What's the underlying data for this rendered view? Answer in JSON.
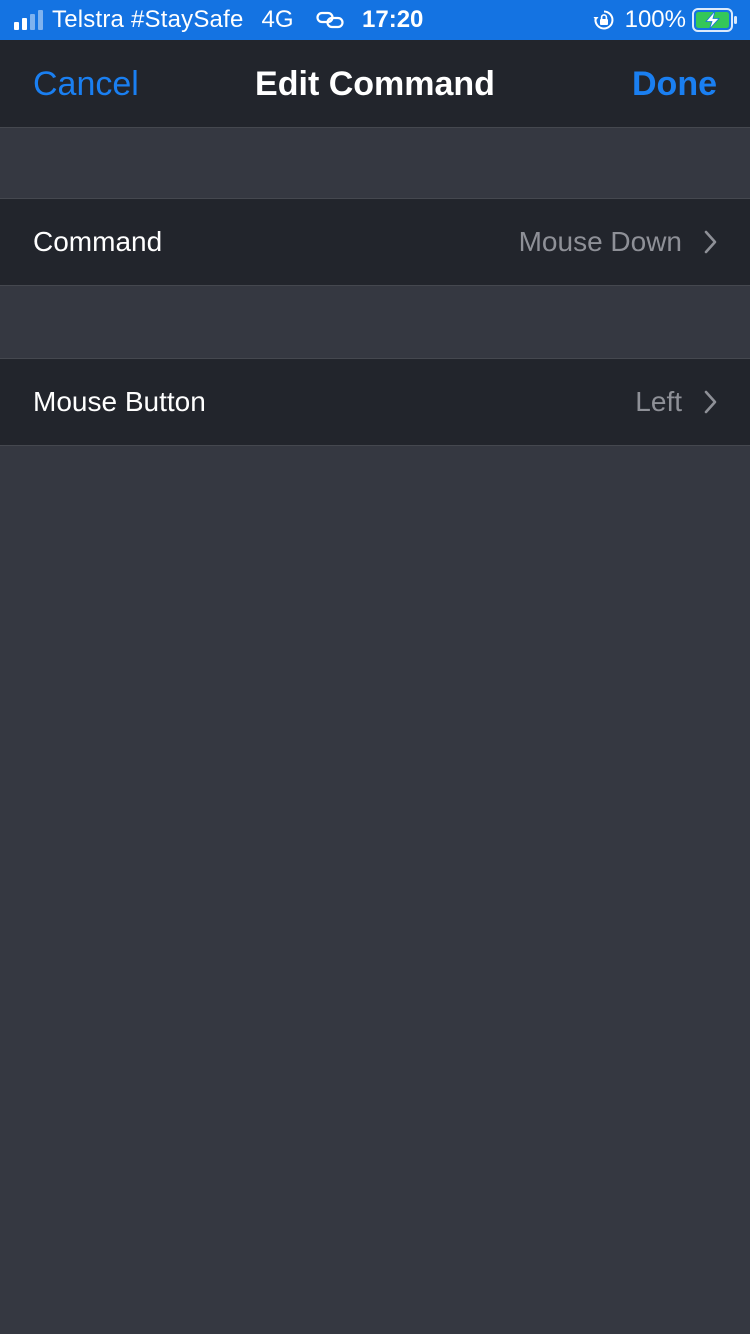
{
  "status_bar": {
    "carrier": "Telstra #StaySafe",
    "network": "4G",
    "time": "17:20",
    "battery": "100%",
    "icons": [
      "signal-icon",
      "link-icon",
      "rotation-lock-icon",
      "battery-charging-icon"
    ]
  },
  "nav": {
    "cancel_label": "Cancel",
    "title": "Edit Command",
    "done_label": "Done"
  },
  "rows": [
    {
      "label": "Command",
      "value": "Mouse Down"
    },
    {
      "label": "Mouse Button",
      "value": "Left"
    }
  ],
  "colors": {
    "accent": "#1a7ff1",
    "status_bar": "#1473e2",
    "background": "#353841",
    "cell_background": "#22252c",
    "secondary_text": "#8e9097",
    "battery_green": "#34c759"
  }
}
